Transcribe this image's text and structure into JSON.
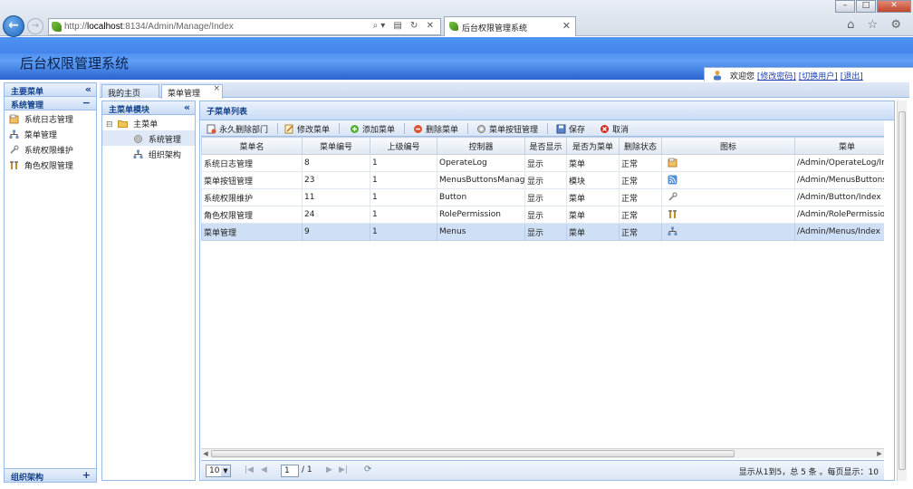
{
  "browser": {
    "url_prefix": "http://",
    "url_host": "localhost",
    "url_rest": ":8134/Admin/Manage/Index",
    "addr_controls": "⌕▾ ▤ ↻ ✕",
    "tab_title": "后台权限管理系统",
    "tab_close": "✕",
    "back": "←",
    "forward": "→",
    "min": "–",
    "max": "□",
    "close": "✕",
    "toolbar_icons": "⌂ ☆ ⚙"
  },
  "banner": {
    "title": "后台权限管理系统"
  },
  "userbar": {
    "welcome": "欢迎您",
    "change_password": "[修改密码]",
    "switch_user": "[切换用户]",
    "logout": "[退出]"
  },
  "left": {
    "header": "主要菜单",
    "collapse": "«",
    "group": "系统管理",
    "group_tool": "−",
    "items": [
      {
        "label": "系统日志管理"
      },
      {
        "label": "菜单管理"
      },
      {
        "label": "系统权限维护"
      },
      {
        "label": "角色权限管理"
      }
    ],
    "bottom_group": "组织架构",
    "bottom_tool": "+"
  },
  "tabs": [
    {
      "label": "我的主页"
    },
    {
      "label": "菜单管理",
      "close": "×"
    }
  ],
  "tree": {
    "header": "主菜单模块",
    "collapse": "«",
    "toggle": "⊟",
    "root": "主菜单",
    "children": [
      {
        "label": "系统管理"
      },
      {
        "label": "组织架构"
      }
    ]
  },
  "grid": {
    "header": "子菜单列表",
    "toolbar": [
      {
        "label": "永久删除部门"
      },
      {
        "label": "修改菜单"
      },
      {
        "label": "添加菜单"
      },
      {
        "label": "删除菜单"
      },
      {
        "label": "菜单按钮管理"
      },
      {
        "label": "保存"
      },
      {
        "label": "取消"
      }
    ],
    "columns": [
      "菜单名",
      "菜单编号",
      "上级编号",
      "控制器",
      "是否显示",
      "是否为菜单",
      "删除状态",
      "图标",
      "菜单"
    ],
    "rows": [
      {
        "name": "系统日志管理",
        "id": "8",
        "parent": "1",
        "controller": "OperateLog",
        "show": "显示",
        "is_menu": "菜单",
        "status": "正常",
        "icon": "log-icon",
        "url": "/Admin/OperateLog/In"
      },
      {
        "name": "菜单按钮管理",
        "id": "23",
        "parent": "1",
        "controller": "MenusButtonsManag",
        "show": "显示",
        "is_menu": "模块",
        "status": "正常",
        "icon": "rss-icon",
        "url": "/Admin/MenusButtons"
      },
      {
        "name": "系统权限维护",
        "id": "11",
        "parent": "1",
        "controller": "Button",
        "show": "显示",
        "is_menu": "菜单",
        "status": "正常",
        "icon": "wrench-icon",
        "url": "/Admin/Button/Index"
      },
      {
        "name": "角色权限管理",
        "id": "24",
        "parent": "1",
        "controller": "RolePermission",
        "show": "显示",
        "is_menu": "菜单",
        "status": "正常",
        "icon": "tools-icon",
        "url": "/Admin/RolePermission"
      },
      {
        "name": "菜单管理",
        "id": "9",
        "parent": "1",
        "controller": "Menus",
        "show": "显示",
        "is_menu": "菜单",
        "status": "正常",
        "icon": "sitemap-icon",
        "url": "/Admin/Menus/Index"
      }
    ],
    "pager": {
      "page_size": "10",
      "dropdown": "▼",
      "first": "|◀",
      "prev": "◀",
      "page": "1",
      "of": "/ 1",
      "next": "▶",
      "last": "▶|",
      "refresh": "⟳",
      "info": "显示从1到5，总 5 条 。每页显示：10"
    }
  },
  "colors": {
    "panel_border": "#99bbe8",
    "header_text": "#15428b",
    "selected_row": "#cfe0f6",
    "banner": "#4d8cf0"
  }
}
